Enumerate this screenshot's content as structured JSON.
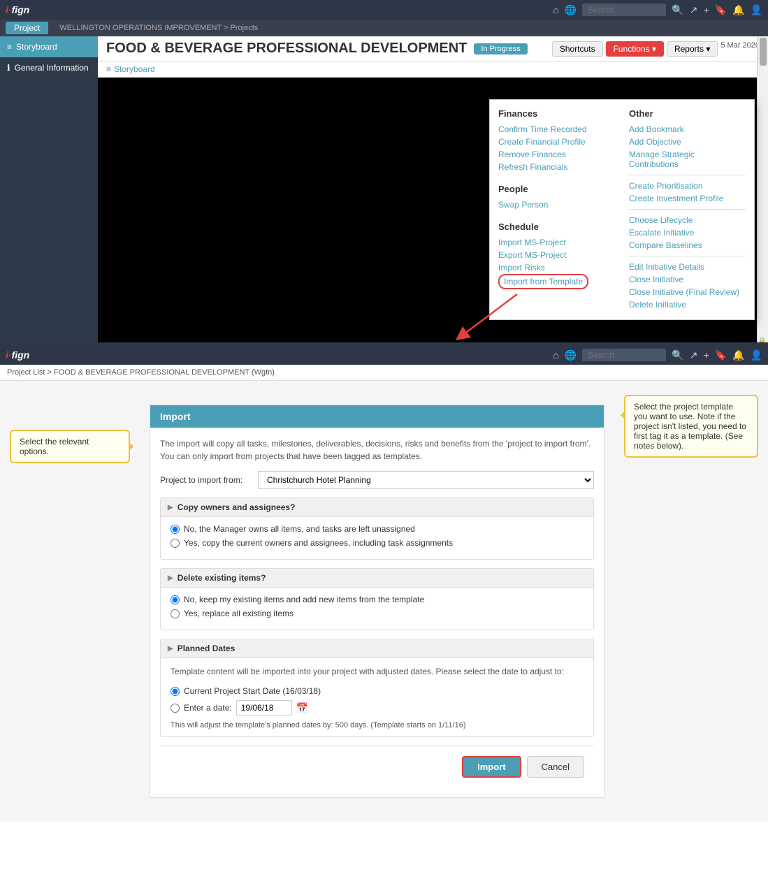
{
  "top": {
    "logo": "i·fign",
    "logo_i": "i·",
    "logo_fign": "fign",
    "header_search_placeholder": "Search",
    "tab_label": "Project",
    "breadcrumb": "WELLINGTON OPERATIONS IMPROVEMENT > Projects",
    "project_title": "FOOD & BEVERAGE PROFESSIONAL DEVELOPMENT",
    "status_label": "In Progress",
    "btn_shortcuts": "Shortcuts",
    "btn_functions": "Functions ▾",
    "btn_reports": "Reports ▾",
    "date_display": "5 Mar 2020",
    "sidebar_items": [
      {
        "id": "storyboard",
        "label": "Storyboard",
        "icon": "≡",
        "active": true
      },
      {
        "id": "general-info",
        "label": "General Information",
        "icon": "ℹ",
        "active": false
      }
    ],
    "sub_nav_storyboard": "Storyboard",
    "dropdown": {
      "finances_title": "Finances",
      "finances_items": [
        {
          "id": "confirm-time",
          "label": "Confirm Time Recorded",
          "highlighted": false
        },
        {
          "id": "create-financial",
          "label": "Create Financial Profile",
          "highlighted": false
        },
        {
          "id": "remove-finances",
          "label": "Remove Finances",
          "highlighted": false
        },
        {
          "id": "refresh-financials",
          "label": "Refresh Financials",
          "highlighted": false
        }
      ],
      "people_title": "People",
      "people_items": [
        {
          "id": "swap-person",
          "label": "Swap Person",
          "highlighted": false
        }
      ],
      "schedule_title": "Schedule",
      "schedule_items": [
        {
          "id": "import-ms-project",
          "label": "Import MS-Project",
          "highlighted": false
        },
        {
          "id": "export-ms-project",
          "label": "Export MS-Project",
          "highlighted": false
        },
        {
          "id": "import-risks",
          "label": "Import Risks",
          "highlighted": false
        },
        {
          "id": "import-template",
          "label": "Import from Template",
          "highlighted": true
        }
      ],
      "other_title": "Other",
      "other_items": [
        {
          "id": "add-bookmark",
          "label": "Add Bookmark",
          "highlighted": false,
          "divider_after": false
        },
        {
          "id": "add-objective",
          "label": "Add Objective",
          "highlighted": false,
          "divider_after": false
        },
        {
          "id": "manage-strategic",
          "label": "Manage Strategic Contributions",
          "highlighted": false,
          "divider_after": true
        },
        {
          "id": "create-prioritisation",
          "label": "Create Prioritisation",
          "highlighted": false,
          "divider_after": false
        },
        {
          "id": "create-investment",
          "label": "Create Investment Profile",
          "highlighted": false,
          "divider_after": true
        },
        {
          "id": "choose-lifecycle",
          "label": "Choose Lifecycle",
          "highlighted": false,
          "divider_after": false
        },
        {
          "id": "escalate-initiative",
          "label": "Escalate Initiative",
          "highlighted": false,
          "divider_after": false
        },
        {
          "id": "compare-baselines",
          "label": "Compare Baselines",
          "highlighted": false,
          "divider_after": true
        },
        {
          "id": "edit-initiative",
          "label": "Edit Initiative Details",
          "highlighted": false,
          "divider_after": false
        },
        {
          "id": "close-initiative",
          "label": "Close Initiative",
          "highlighted": false,
          "divider_after": false
        },
        {
          "id": "close-initiative-final",
          "label": "Close Initiative (Final Review)",
          "highlighted": false,
          "divider_after": false
        },
        {
          "id": "delete-initiative",
          "label": "Delete Initiative",
          "highlighted": false,
          "divider_after": false
        }
      ]
    }
  },
  "bottom": {
    "logo": "i·fign",
    "breadcrumb": "Project List > FOOD & BEVERAGE PROFESSIONAL DEVELOPMENT (Wgtn)",
    "search_placeholder": "Search",
    "import_form": {
      "title": "Import",
      "description": "The import will copy all tasks, milestones, deliverables, decisions, risks and benefits from the 'project to import from'. You can only import from projects that have been tagged as templates.",
      "project_label": "Project to import from:",
      "project_value": "Christchurch Hotel Planning",
      "copy_owners_title": "Copy owners and assignees?",
      "copy_options": [
        {
          "id": "no-copy",
          "label": "No, the Manager owns all items, and tasks are left unassigned",
          "checked": true
        },
        {
          "id": "yes-copy",
          "label": "Yes, copy the current owners and assignees, including task assignments",
          "checked": false
        }
      ],
      "delete_existing_title": "Delete existing items?",
      "delete_options": [
        {
          "id": "no-delete",
          "label": "No, keep my existing items and add new items from the template",
          "checked": true
        },
        {
          "id": "yes-delete",
          "label": "Yes, replace all existing items",
          "checked": false
        }
      ],
      "planned_dates_title": "Planned Dates",
      "planned_dates_desc": "Template content will be imported into your project with adjusted dates. Please select the date to adjust to:",
      "date_options": [
        {
          "id": "current-start",
          "label": "Current Project Start Date (16/03/18)",
          "checked": true
        },
        {
          "id": "enter-date",
          "label": "Enter a date:",
          "checked": false
        }
      ],
      "date_value": "19/06/18",
      "adjust_text": "This will adjust the template's planned dates by:  500  days. (Template starts on 1/11/16)",
      "btn_import": "Import",
      "btn_cancel": "Cancel"
    },
    "tooltip_left": "Select the relevant options.",
    "tooltip_right": "Select the project template you want to use.  Note if the project isn't listed, you need to first tag it as a template. (See notes below)."
  }
}
